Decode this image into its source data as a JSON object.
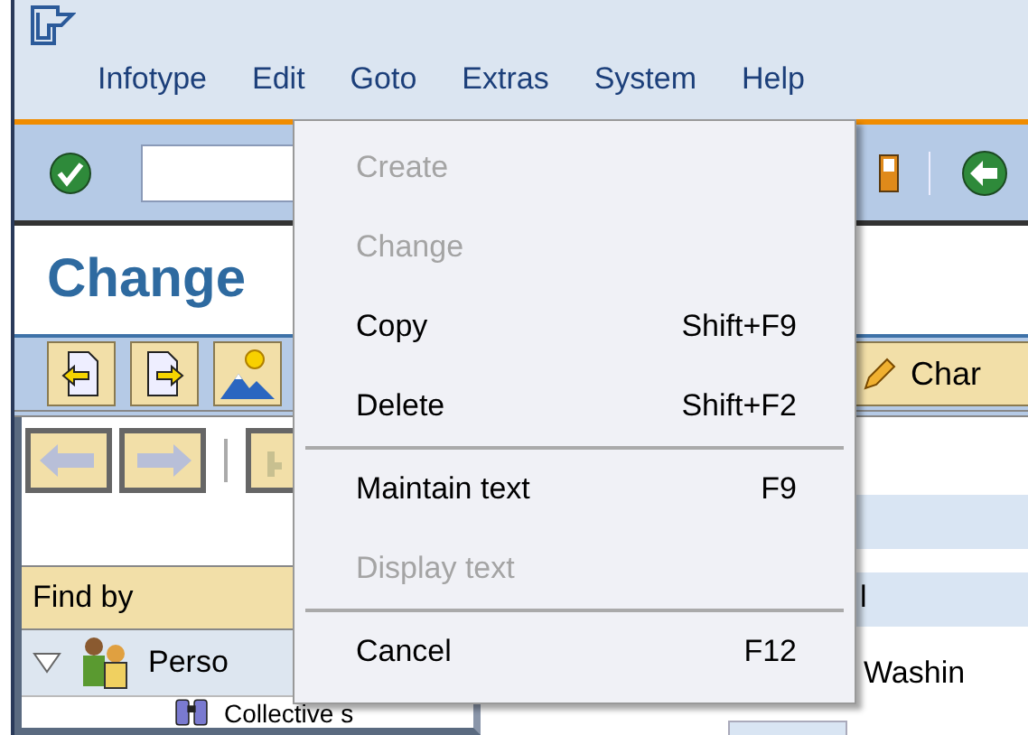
{
  "menu_bar": [
    {
      "label": "Infotype"
    },
    {
      "label": "Edit"
    },
    {
      "label": "Goto"
    },
    {
      "label": "Extras"
    },
    {
      "label": "System"
    },
    {
      "label": "Help"
    }
  ],
  "title": "Change",
  "app_toolbar": {
    "change_button": "Char"
  },
  "navigator": {
    "header": "Find by",
    "tree": [
      {
        "label": "Perso",
        "expanded": true,
        "children": [
          {
            "label": "Collective s"
          }
        ]
      }
    ]
  },
  "detail": {
    "cut_text": "l",
    "field_label": "Washin"
  },
  "dropdown": [
    {
      "kind": "item",
      "label": "Create",
      "disabled": true
    },
    {
      "kind": "item",
      "label": "Change",
      "disabled": true
    },
    {
      "kind": "item",
      "label": "Copy",
      "shortcut": "Shift+F9",
      "disabled": false
    },
    {
      "kind": "item",
      "label": "Delete",
      "shortcut": "Shift+F2",
      "disabled": false
    },
    {
      "kind": "separator"
    },
    {
      "kind": "item",
      "label": "Maintain text",
      "shortcut": "F9",
      "disabled": false
    },
    {
      "kind": "item",
      "label": "Display text",
      "disabled": true
    },
    {
      "kind": "separator"
    },
    {
      "kind": "item",
      "label": "Cancel",
      "shortcut": "F12",
      "disabled": false
    }
  ]
}
